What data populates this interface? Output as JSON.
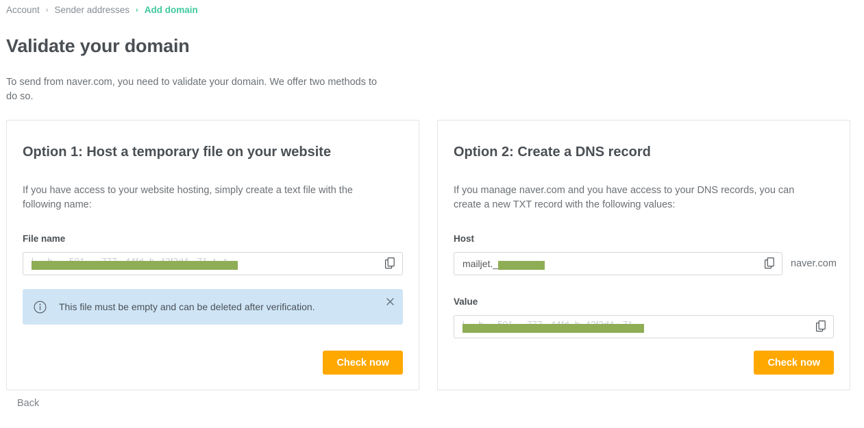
{
  "breadcrumb": {
    "items": [
      {
        "label": "Account",
        "active": false
      },
      {
        "label": "Sender addresses",
        "active": false
      },
      {
        "label": "Add domain",
        "active": true
      }
    ],
    "separator": "›"
  },
  "page": {
    "title": "Validate your domain",
    "intro": "To send from naver.com, you need to validate your domain. We offer two methods to do so.",
    "domain": "naver.com",
    "back_label": "Back"
  },
  "option1": {
    "title": "Option 1: Host a temporary file on your website",
    "description": "If you have access to your website hosting, simply create a text file with the following name:",
    "file_name_label": "File name",
    "file_name_value": "",
    "file_name_redacted": true,
    "copy_icon": "copy-icon",
    "alert": {
      "icon": "info-circle-icon",
      "text": "This file must be empty and can be deleted after verification.",
      "close_icon": "close-icon"
    },
    "check_button": "Check now"
  },
  "option2": {
    "title": "Option 2: Create a DNS record",
    "description": "If you manage naver.com and you have access to your DNS records, you can create a new TXT record with the following values:",
    "host_label": "Host",
    "host_value_prefix": "mailjet._",
    "host_value_redacted": true,
    "host_suffix": "naver.com",
    "value_label": "Value",
    "value_redacted": true,
    "copy_icon": "copy-icon",
    "check_button": "Check now"
  },
  "colors": {
    "accent_green": "#3fc99e",
    "button_orange": "#ffa800",
    "redaction_green": "#8ead55",
    "alert_blue": "#cfe5f6",
    "card_border": "#e2e4e6",
    "text": "#55595c",
    "heading": "#4a4f54"
  }
}
